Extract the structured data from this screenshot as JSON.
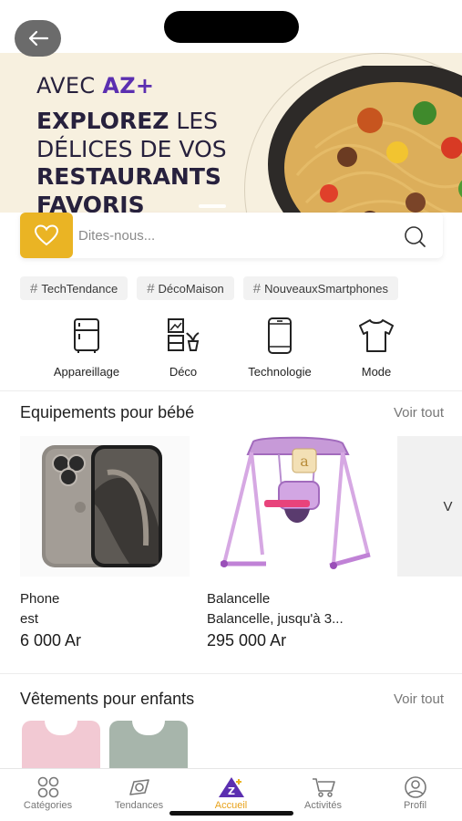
{
  "hero": {
    "line1_prefix": "AVEC ",
    "line1_brand": "AZ+",
    "line2_bold": "EXPLOREZ",
    "line2_rest": " LES",
    "line3": "DÉLICES DE VOS",
    "line4": "RESTAURANTS",
    "line5": "FAVORIS"
  },
  "search": {
    "placeholder": "Dites-nous..."
  },
  "tags": [
    "TechTendance",
    "DécoMaison",
    "NouveauxSmartphones"
  ],
  "categories": [
    {
      "label": "Appareillage",
      "icon": "fridge-icon"
    },
    {
      "label": "Déco",
      "icon": "decor-icon"
    },
    {
      "label": "Technologie",
      "icon": "smartphone-icon"
    },
    {
      "label": "Mode",
      "icon": "tshirt-icon"
    }
  ],
  "section_baby": {
    "title": "Equipements pour  bébé",
    "see_all": "Voir tout",
    "products": [
      {
        "name": "Phone",
        "subtitle": "est",
        "price": "6 000 Ar"
      },
      {
        "name": "Balancelle",
        "subtitle": "Balancelle, jusqu'à 3...",
        "price": "295 000 Ar"
      }
    ],
    "next_card_label": "V"
  },
  "section_kids": {
    "title": "Vêtements pour enfants",
    "see_all": "Voir tout"
  },
  "bottom_nav": [
    {
      "label": "Catégories",
      "icon": "grid-icon"
    },
    {
      "label": "Tendances",
      "icon": "trend-icon"
    },
    {
      "label": "Accueil",
      "icon": "home-logo-icon",
      "active": true
    },
    {
      "label": "Activités",
      "icon": "cart-icon"
    },
    {
      "label": "Profil",
      "icon": "profile-icon"
    }
  ],
  "colors": {
    "accent": "#eab424",
    "brand_purple": "#5b2fb0",
    "hero_bg": "#f7f0df",
    "nav_active": "#e8a21a"
  }
}
